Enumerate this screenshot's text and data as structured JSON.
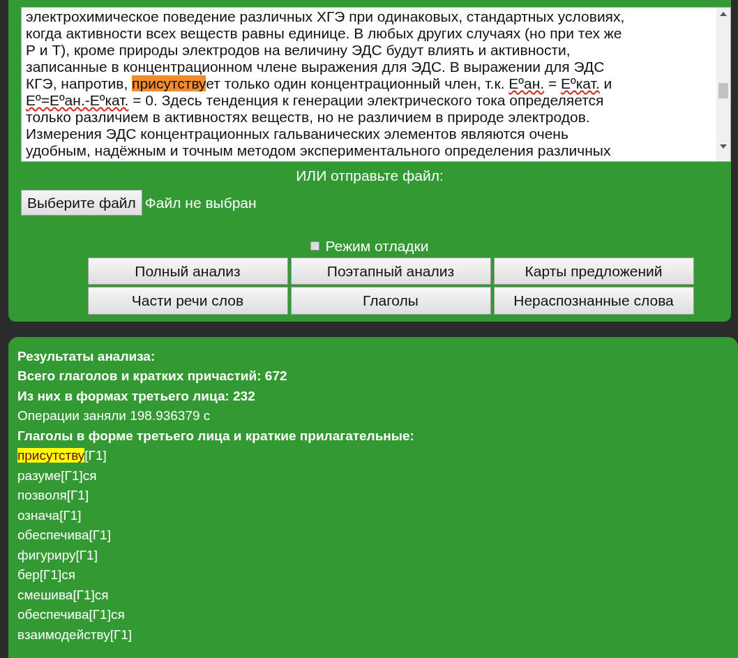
{
  "text_area": {
    "lines": [
      [
        {
          "text": "электрохимическое поведение различных ХГЭ при одинаковых, стандартных условиях,",
          "kind": "plain"
        }
      ],
      [
        {
          "text": "когда активности всех веществ равны единице. В любых других случаях (но при тех же",
          "kind": "plain"
        }
      ],
      [
        {
          "text": "Р и Т), кроме природы электродов на величину ЭДС будут влиять и активности,",
          "kind": "plain"
        }
      ],
      [
        {
          "text": "записанные в концентрационном члене выражения для ЭДС. В выражении для ЭДС",
          "kind": "plain"
        }
      ],
      [
        {
          "text": "КГЭ, напротив, ",
          "kind": "plain"
        },
        {
          "text": "присутству",
          "kind": "highlight"
        },
        {
          "text": "ет только один концентрационный член, т.к. ",
          "kind": "plain"
        },
        {
          "text": "Еºан.",
          "kind": "misspelled"
        },
        {
          "text": " = ",
          "kind": "plain"
        },
        {
          "text": "Еºкат.",
          "kind": "misspelled"
        },
        {
          "text": " и",
          "kind": "plain"
        }
      ],
      [
        {
          "text": "Еº=Еºан.-Еºкат.",
          "kind": "misspelled"
        },
        {
          "text": " = 0. Здесь тенденция к генерации электрического тока определяется",
          "kind": "plain"
        }
      ],
      [
        {
          "text": "только различием в активностях веществ, но не различием в природе электродов.",
          "kind": "plain"
        }
      ],
      [
        {
          "text": "Измерения ЭДС концентрационных гальванических элементов являются очень",
          "kind": "plain"
        }
      ],
      [
        {
          "text": "удобным, надёжным и точным методом экспериментального определения различных",
          "kind": "plain"
        }
      ]
    ]
  },
  "file_prompt": "ИЛИ отправьте файл:",
  "file_button": "Выберите файл",
  "file_status": "Файл не выбран",
  "debug_mode": {
    "label": "Режим отладки",
    "checked": false
  },
  "buttons": [
    "Полный анализ",
    "Поэтапный анализ",
    "Карты предложений",
    "Части речи слов",
    "Глаголы",
    "Нераспознанные слова"
  ],
  "results": {
    "lines": [
      {
        "text": "Результаты анализа:",
        "bold": true
      },
      {
        "text": "Всего глаголов и кратких причастий: 672",
        "bold": true
      },
      {
        "text": "Из них в формах третьего лица: 232",
        "bold": true
      },
      {
        "text": "Операции заняли 198.936379 с",
        "bold": false
      },
      {
        "text": "Глаголы в форме третьего лица и краткие прилагательные:",
        "bold": true
      }
    ],
    "words": [
      {
        "stem": "присутству",
        "tag": "[Г1]",
        "selected": true
      },
      {
        "stem": "разуме",
        "tag": "[Г1]",
        "suffix": "ся",
        "selected": false
      },
      {
        "stem": "позволя",
        "tag": "[Г1]",
        "selected": false
      },
      {
        "stem": "означа",
        "tag": "[Г1]",
        "selected": false
      },
      {
        "stem": "обеспечива",
        "tag": "[Г1]",
        "selected": false
      },
      {
        "stem": "фигуриру",
        "tag": "[Г1]",
        "selected": false
      },
      {
        "stem": "бер",
        "tag": "[Г1]",
        "suffix": "ся",
        "selected": false
      },
      {
        "stem": "смешива",
        "tag": "[Г1]",
        "suffix": "ся",
        "selected": false
      },
      {
        "stem": "обеспечива",
        "tag": "[Г1]",
        "suffix": "ся",
        "selected": false
      },
      {
        "stem": "взаимодейству",
        "tag": "[Г1]",
        "selected": false
      }
    ]
  }
}
